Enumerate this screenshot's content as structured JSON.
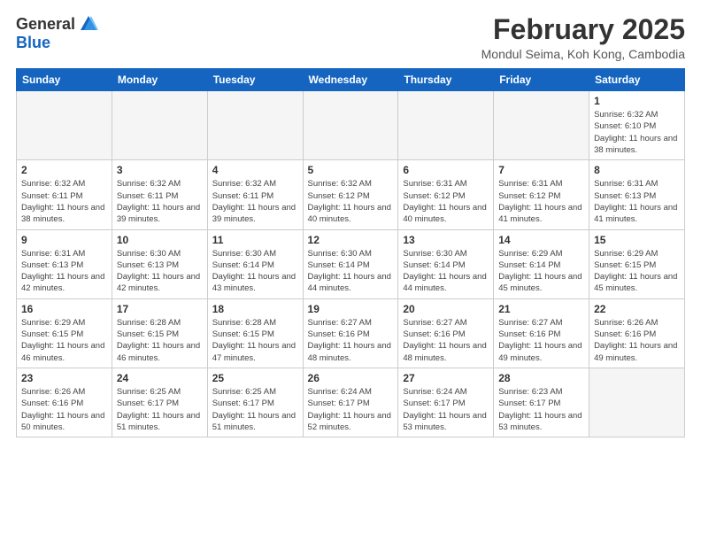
{
  "header": {
    "logo_general": "General",
    "logo_blue": "Blue",
    "month_title": "February 2025",
    "location": "Mondul Seima, Koh Kong, Cambodia"
  },
  "weekdays": [
    "Sunday",
    "Monday",
    "Tuesday",
    "Wednesday",
    "Thursday",
    "Friday",
    "Saturday"
  ],
  "weeks": [
    [
      {
        "day": "",
        "info": ""
      },
      {
        "day": "",
        "info": ""
      },
      {
        "day": "",
        "info": ""
      },
      {
        "day": "",
        "info": ""
      },
      {
        "day": "",
        "info": ""
      },
      {
        "day": "",
        "info": ""
      },
      {
        "day": "1",
        "info": "Sunrise: 6:32 AM\nSunset: 6:10 PM\nDaylight: 11 hours\nand 38 minutes."
      }
    ],
    [
      {
        "day": "2",
        "info": "Sunrise: 6:32 AM\nSunset: 6:11 PM\nDaylight: 11 hours\nand 38 minutes."
      },
      {
        "day": "3",
        "info": "Sunrise: 6:32 AM\nSunset: 6:11 PM\nDaylight: 11 hours\nand 39 minutes."
      },
      {
        "day": "4",
        "info": "Sunrise: 6:32 AM\nSunset: 6:11 PM\nDaylight: 11 hours\nand 39 minutes."
      },
      {
        "day": "5",
        "info": "Sunrise: 6:32 AM\nSunset: 6:12 PM\nDaylight: 11 hours\nand 40 minutes."
      },
      {
        "day": "6",
        "info": "Sunrise: 6:31 AM\nSunset: 6:12 PM\nDaylight: 11 hours\nand 40 minutes."
      },
      {
        "day": "7",
        "info": "Sunrise: 6:31 AM\nSunset: 6:12 PM\nDaylight: 11 hours\nand 41 minutes."
      },
      {
        "day": "8",
        "info": "Sunrise: 6:31 AM\nSunset: 6:13 PM\nDaylight: 11 hours\nand 41 minutes."
      }
    ],
    [
      {
        "day": "9",
        "info": "Sunrise: 6:31 AM\nSunset: 6:13 PM\nDaylight: 11 hours\nand 42 minutes."
      },
      {
        "day": "10",
        "info": "Sunrise: 6:30 AM\nSunset: 6:13 PM\nDaylight: 11 hours\nand 42 minutes."
      },
      {
        "day": "11",
        "info": "Sunrise: 6:30 AM\nSunset: 6:14 PM\nDaylight: 11 hours\nand 43 minutes."
      },
      {
        "day": "12",
        "info": "Sunrise: 6:30 AM\nSunset: 6:14 PM\nDaylight: 11 hours\nand 44 minutes."
      },
      {
        "day": "13",
        "info": "Sunrise: 6:30 AM\nSunset: 6:14 PM\nDaylight: 11 hours\nand 44 minutes."
      },
      {
        "day": "14",
        "info": "Sunrise: 6:29 AM\nSunset: 6:14 PM\nDaylight: 11 hours\nand 45 minutes."
      },
      {
        "day": "15",
        "info": "Sunrise: 6:29 AM\nSunset: 6:15 PM\nDaylight: 11 hours\nand 45 minutes."
      }
    ],
    [
      {
        "day": "16",
        "info": "Sunrise: 6:29 AM\nSunset: 6:15 PM\nDaylight: 11 hours\nand 46 minutes."
      },
      {
        "day": "17",
        "info": "Sunrise: 6:28 AM\nSunset: 6:15 PM\nDaylight: 11 hours\nand 46 minutes."
      },
      {
        "day": "18",
        "info": "Sunrise: 6:28 AM\nSunset: 6:15 PM\nDaylight: 11 hours\nand 47 minutes."
      },
      {
        "day": "19",
        "info": "Sunrise: 6:27 AM\nSunset: 6:16 PM\nDaylight: 11 hours\nand 48 minutes."
      },
      {
        "day": "20",
        "info": "Sunrise: 6:27 AM\nSunset: 6:16 PM\nDaylight: 11 hours\nand 48 minutes."
      },
      {
        "day": "21",
        "info": "Sunrise: 6:27 AM\nSunset: 6:16 PM\nDaylight: 11 hours\nand 49 minutes."
      },
      {
        "day": "22",
        "info": "Sunrise: 6:26 AM\nSunset: 6:16 PM\nDaylight: 11 hours\nand 49 minutes."
      }
    ],
    [
      {
        "day": "23",
        "info": "Sunrise: 6:26 AM\nSunset: 6:16 PM\nDaylight: 11 hours\nand 50 minutes."
      },
      {
        "day": "24",
        "info": "Sunrise: 6:25 AM\nSunset: 6:17 PM\nDaylight: 11 hours\nand 51 minutes."
      },
      {
        "day": "25",
        "info": "Sunrise: 6:25 AM\nSunset: 6:17 PM\nDaylight: 11 hours\nand 51 minutes."
      },
      {
        "day": "26",
        "info": "Sunrise: 6:24 AM\nSunset: 6:17 PM\nDaylight: 11 hours\nand 52 minutes."
      },
      {
        "day": "27",
        "info": "Sunrise: 6:24 AM\nSunset: 6:17 PM\nDaylight: 11 hours\nand 53 minutes."
      },
      {
        "day": "28",
        "info": "Sunrise: 6:23 AM\nSunset: 6:17 PM\nDaylight: 11 hours\nand 53 minutes."
      },
      {
        "day": "",
        "info": ""
      }
    ]
  ]
}
